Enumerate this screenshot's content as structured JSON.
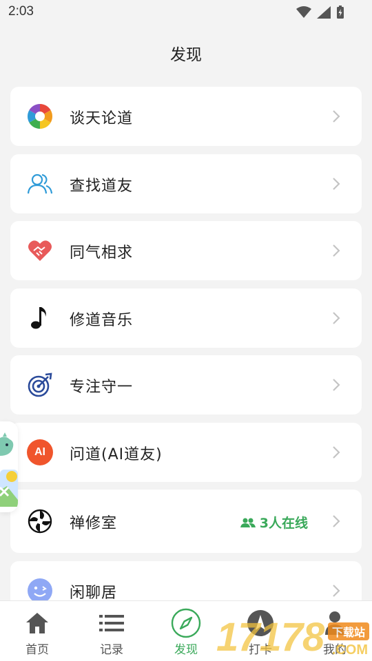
{
  "status_bar": {
    "time": "2:03"
  },
  "page": {
    "title": "发现"
  },
  "items": [
    {
      "label": "谈天论道",
      "icon": "camera-aperture-icon"
    },
    {
      "label": "查找道友",
      "icon": "users-icon"
    },
    {
      "label": "同气相求",
      "icon": "heart-handshake-icon"
    },
    {
      "label": "修道音乐",
      "icon": "music-note-icon"
    },
    {
      "label": "专注守一",
      "icon": "target-arrow-icon"
    },
    {
      "label": "问道(AI道友)",
      "icon": "ai-badge-icon",
      "icon_text": "AI"
    },
    {
      "label": "禅修室",
      "icon": "spiral-icon",
      "badge": "3人在线"
    },
    {
      "label": "闲聊居",
      "icon": "wink-face-icon"
    }
  ],
  "tabs": [
    {
      "label": "首页",
      "icon": "home-icon"
    },
    {
      "label": "记录",
      "icon": "list-icon"
    },
    {
      "label": "发现",
      "icon": "compass-icon",
      "active": true
    },
    {
      "label": "打卡",
      "icon": "checkin-icon"
    },
    {
      "label": "我的",
      "icon": "person-icon"
    }
  ],
  "watermark": {
    "main": "17178",
    "badge": "下载站",
    "suffix": ".COM"
  },
  "colors": {
    "accent": "#3aa95a",
    "background": "#f3f3f3",
    "card": "#ffffff",
    "ai_badge": "#f0552c"
  }
}
